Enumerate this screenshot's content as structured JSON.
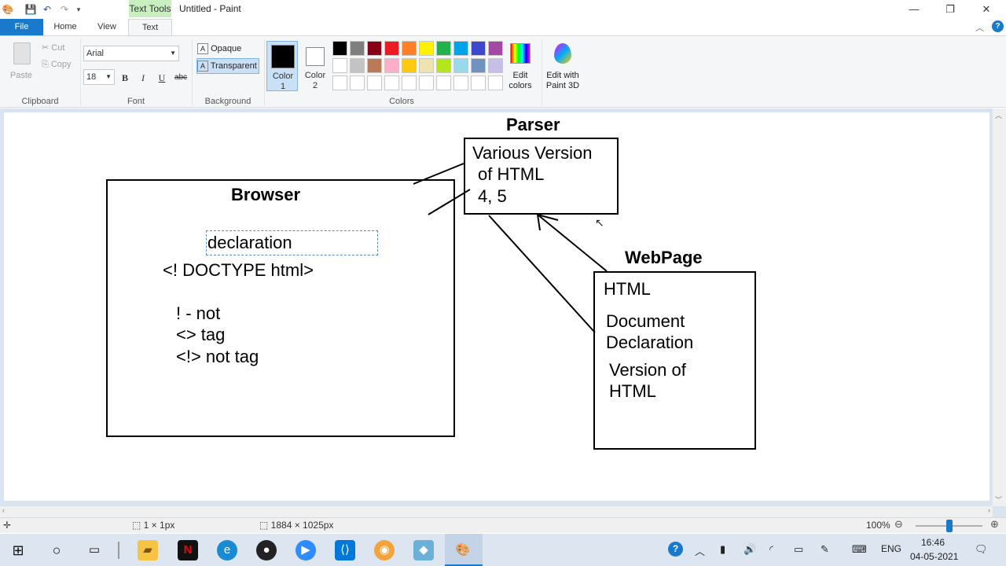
{
  "titlebar": {
    "context_tab": "Text Tools",
    "title": "Untitled - Paint",
    "minimize": "—",
    "restore": "❐",
    "close": "✕"
  },
  "tabs": {
    "file": "File",
    "home": "Home",
    "view": "View",
    "text": "Text"
  },
  "clipboard": {
    "paste": "Paste",
    "cut": "Cut",
    "copy": "Copy",
    "label": "Clipboard"
  },
  "font": {
    "family": "Arial",
    "size": "18",
    "bold": "B",
    "italic": "I",
    "underline": "U",
    "strike": "abc",
    "label": "Font"
  },
  "background": {
    "opaque": "Opaque",
    "transparent": "Transparent",
    "label": "Background"
  },
  "colors": {
    "color1": "Color 1",
    "color1_a": "Color",
    "color1_b": "1",
    "color2_a": "Color",
    "color2_b": "2",
    "edit_a": "Edit",
    "edit_b": "colors",
    "paint3d_a": "Edit with",
    "paint3d_b": "Paint 3D",
    "label": "Colors",
    "color1_value": "#000000",
    "color2_value": "#ffffff",
    "palette_row1": [
      "#000000",
      "#7f7f7f",
      "#880015",
      "#ed1c24",
      "#ff7f27",
      "#fff200",
      "#22b14c",
      "#00a2e8",
      "#3f48cc",
      "#a349a4"
    ],
    "palette_row2": [
      "#ffffff",
      "#c3c3c3",
      "#b97a57",
      "#ffaec9",
      "#ffc90e",
      "#efe4b0",
      "#b5e61d",
      "#99d9ea",
      "#7092be",
      "#c8bfe7"
    ],
    "palette_row3": [
      "#ffffff",
      "#ffffff",
      "#ffffff",
      "#ffffff",
      "#ffffff",
      "#ffffff",
      "#ffffff",
      "#ffffff",
      "#ffffff",
      "#ffffff"
    ]
  },
  "canvas": {
    "parser_title": "Parser",
    "parser_line1": "Various Version",
    "parser_line2": "of HTML",
    "parser_line3": "4, 5",
    "browser_title": "Browser",
    "declaration": "declaration",
    "doctype": "<! DOCTYPE html>",
    "note1": "! - not",
    "note2": "<> tag",
    "note3": "<!> not tag",
    "webpage_title": "WebPage",
    "webpage_line1": "HTML",
    "webpage_line2": "Document",
    "webpage_line3": "Declaration",
    "webpage_line4": "Version of",
    "webpage_line5": "HTML"
  },
  "status": {
    "selection": "1 × 1px",
    "image_size": "1884 × 1025px",
    "zoom": "100%"
  },
  "taskbar": {
    "lang": "ENG",
    "time": "16:46",
    "date": "04-05-2021"
  }
}
